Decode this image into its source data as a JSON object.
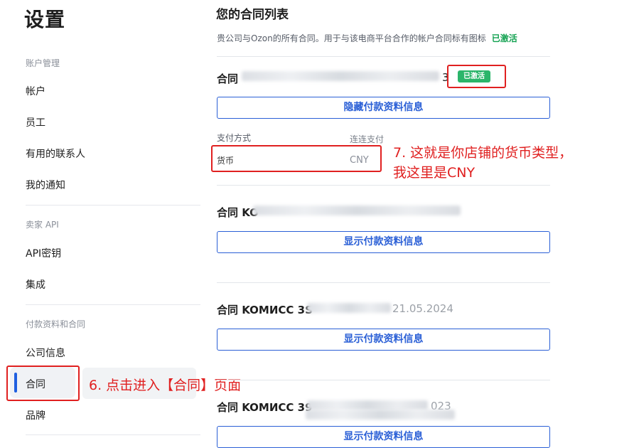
{
  "sidebar": {
    "title": "设置",
    "sections": [
      {
        "heading": "账户管理",
        "items": [
          "帐户",
          "员工",
          "有用的联系人",
          "我的通知"
        ]
      },
      {
        "heading": "卖家 API",
        "items": [
          "API密钥",
          "集成"
        ]
      },
      {
        "heading": "付款资料和合同",
        "items": [
          "公司信息",
          "合同",
          "品牌"
        ]
      }
    ]
  },
  "main": {
    "title": "您的合同列表",
    "subtitle": "贵公司与Ozon的所有合同。用于与该电商平台合作的帐户合同标有图标",
    "subtitle_status": "已激活",
    "contracts": [
      {
        "name_prefix": "合同",
        "name_suffix": "3",
        "badge": "已激活",
        "button": "隐藏付款资料信息",
        "payment_method_label": "支付方式",
        "payment_method_value": "连连支付",
        "currency_label": "货币",
        "currency_value": "CNY"
      },
      {
        "name_prefix": "合同 KO",
        "button": "显示付款资料信息"
      },
      {
        "name_prefix": "合同 KOMИCC 3S",
        "name_suffix": "21.05.2024",
        "button": "显示付款资料信息"
      },
      {
        "name_prefix": "合同 KOMИCC 39",
        "name_suffix": "023",
        "button": "显示付款资料信息"
      }
    ]
  },
  "annotations": {
    "step7_line1": "7. 这就是你店铺的货币类型，",
    "step7_line2": "我这里是CNY",
    "step6": "6. 点击进入【合同】页面"
  },
  "colors": {
    "accent": "#2a5fd6",
    "active_badge": "#2bb56a",
    "annotation": "#e02020"
  }
}
